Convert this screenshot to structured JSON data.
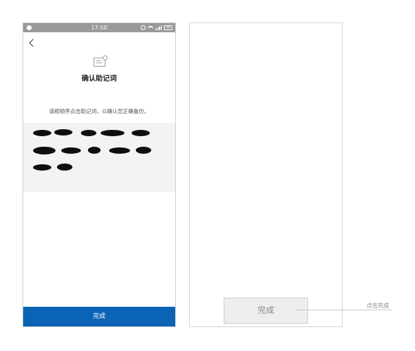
{
  "status_bar": {
    "time": "17:50",
    "battery": "98"
  },
  "screen": {
    "title": "确认助记词",
    "instruction": "请按顺序点击助记词，以确认您正确备份。",
    "done_label": "完成",
    "mnemonic_words_redacted": 12
  },
  "wireframe": {
    "done_label": "完成",
    "annotation": "点击完成"
  },
  "colors": {
    "primary_blue": "#0a63b4",
    "status_bar_gray": "#9a9a9a",
    "word_area_bg": "#f3f3f5"
  }
}
